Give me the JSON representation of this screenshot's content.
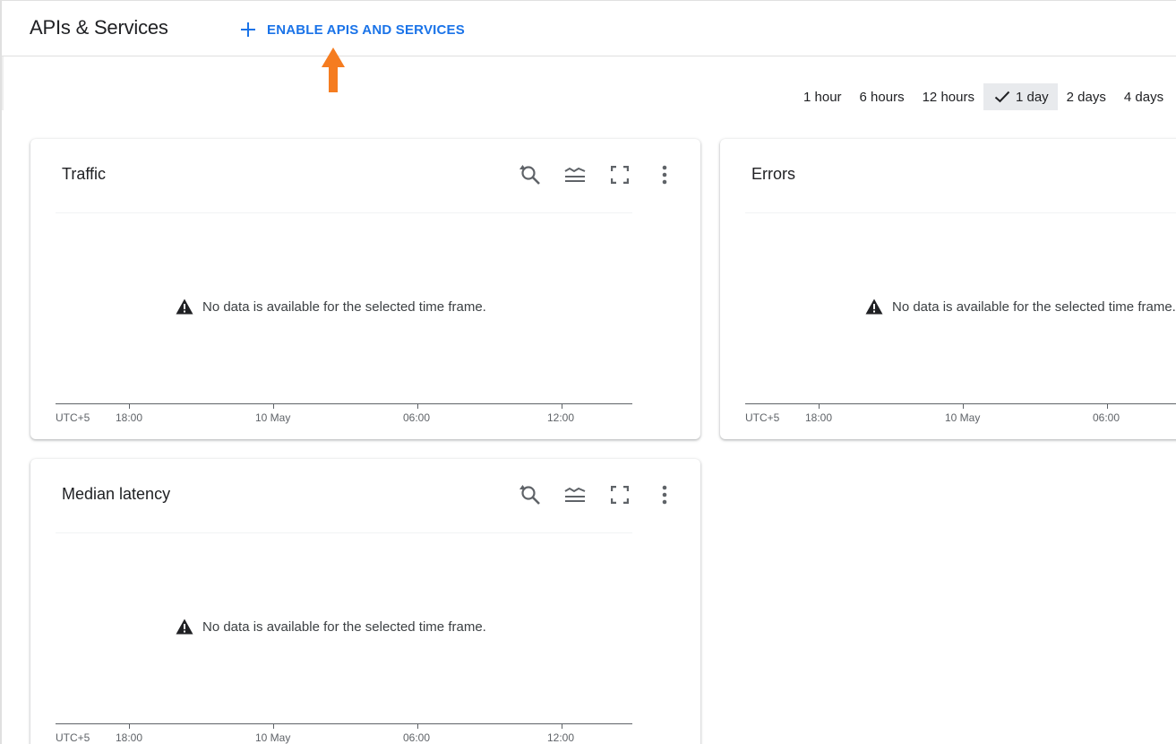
{
  "header": {
    "title": "APIs & Services",
    "enable_button_label": "ENABLE APIS AND SERVICES"
  },
  "time_range": {
    "options": [
      "1 hour",
      "6 hours",
      "12 hours",
      "1 day",
      "2 days",
      "4 days"
    ],
    "selected": "1 day"
  },
  "cards": {
    "traffic": {
      "title": "Traffic",
      "no_data": "No data is available for the selected time frame.",
      "axis": {
        "timezone": "UTC+5",
        "ticks": [
          "18:00",
          "10 May",
          "06:00",
          "12:00"
        ]
      }
    },
    "errors": {
      "title": "Errors",
      "no_data": "No data is available for the selected time frame.",
      "axis": {
        "timezone": "UTC+5",
        "ticks": [
          "18:00",
          "10 May",
          "06:00"
        ]
      }
    },
    "latency": {
      "title": "Median latency",
      "no_data": "No data is available for the selected time frame.",
      "axis": {
        "timezone": "UTC+5",
        "ticks": [
          "18:00",
          "10 May",
          "06:00",
          "12:00"
        ]
      }
    }
  },
  "icons": {
    "reset_zoom": "zoom-reset-icon",
    "legend": "legend-icon",
    "fullscreen": "fullscreen-icon",
    "more": "more-vert-icon",
    "warning": "warning-icon",
    "check": "check-icon",
    "annotation_arrow": "arrow-up-icon"
  },
  "colors": {
    "accent": "#1a73e8",
    "annotation_arrow": "#f57c20",
    "selected_bg": "#e8eaed"
  }
}
